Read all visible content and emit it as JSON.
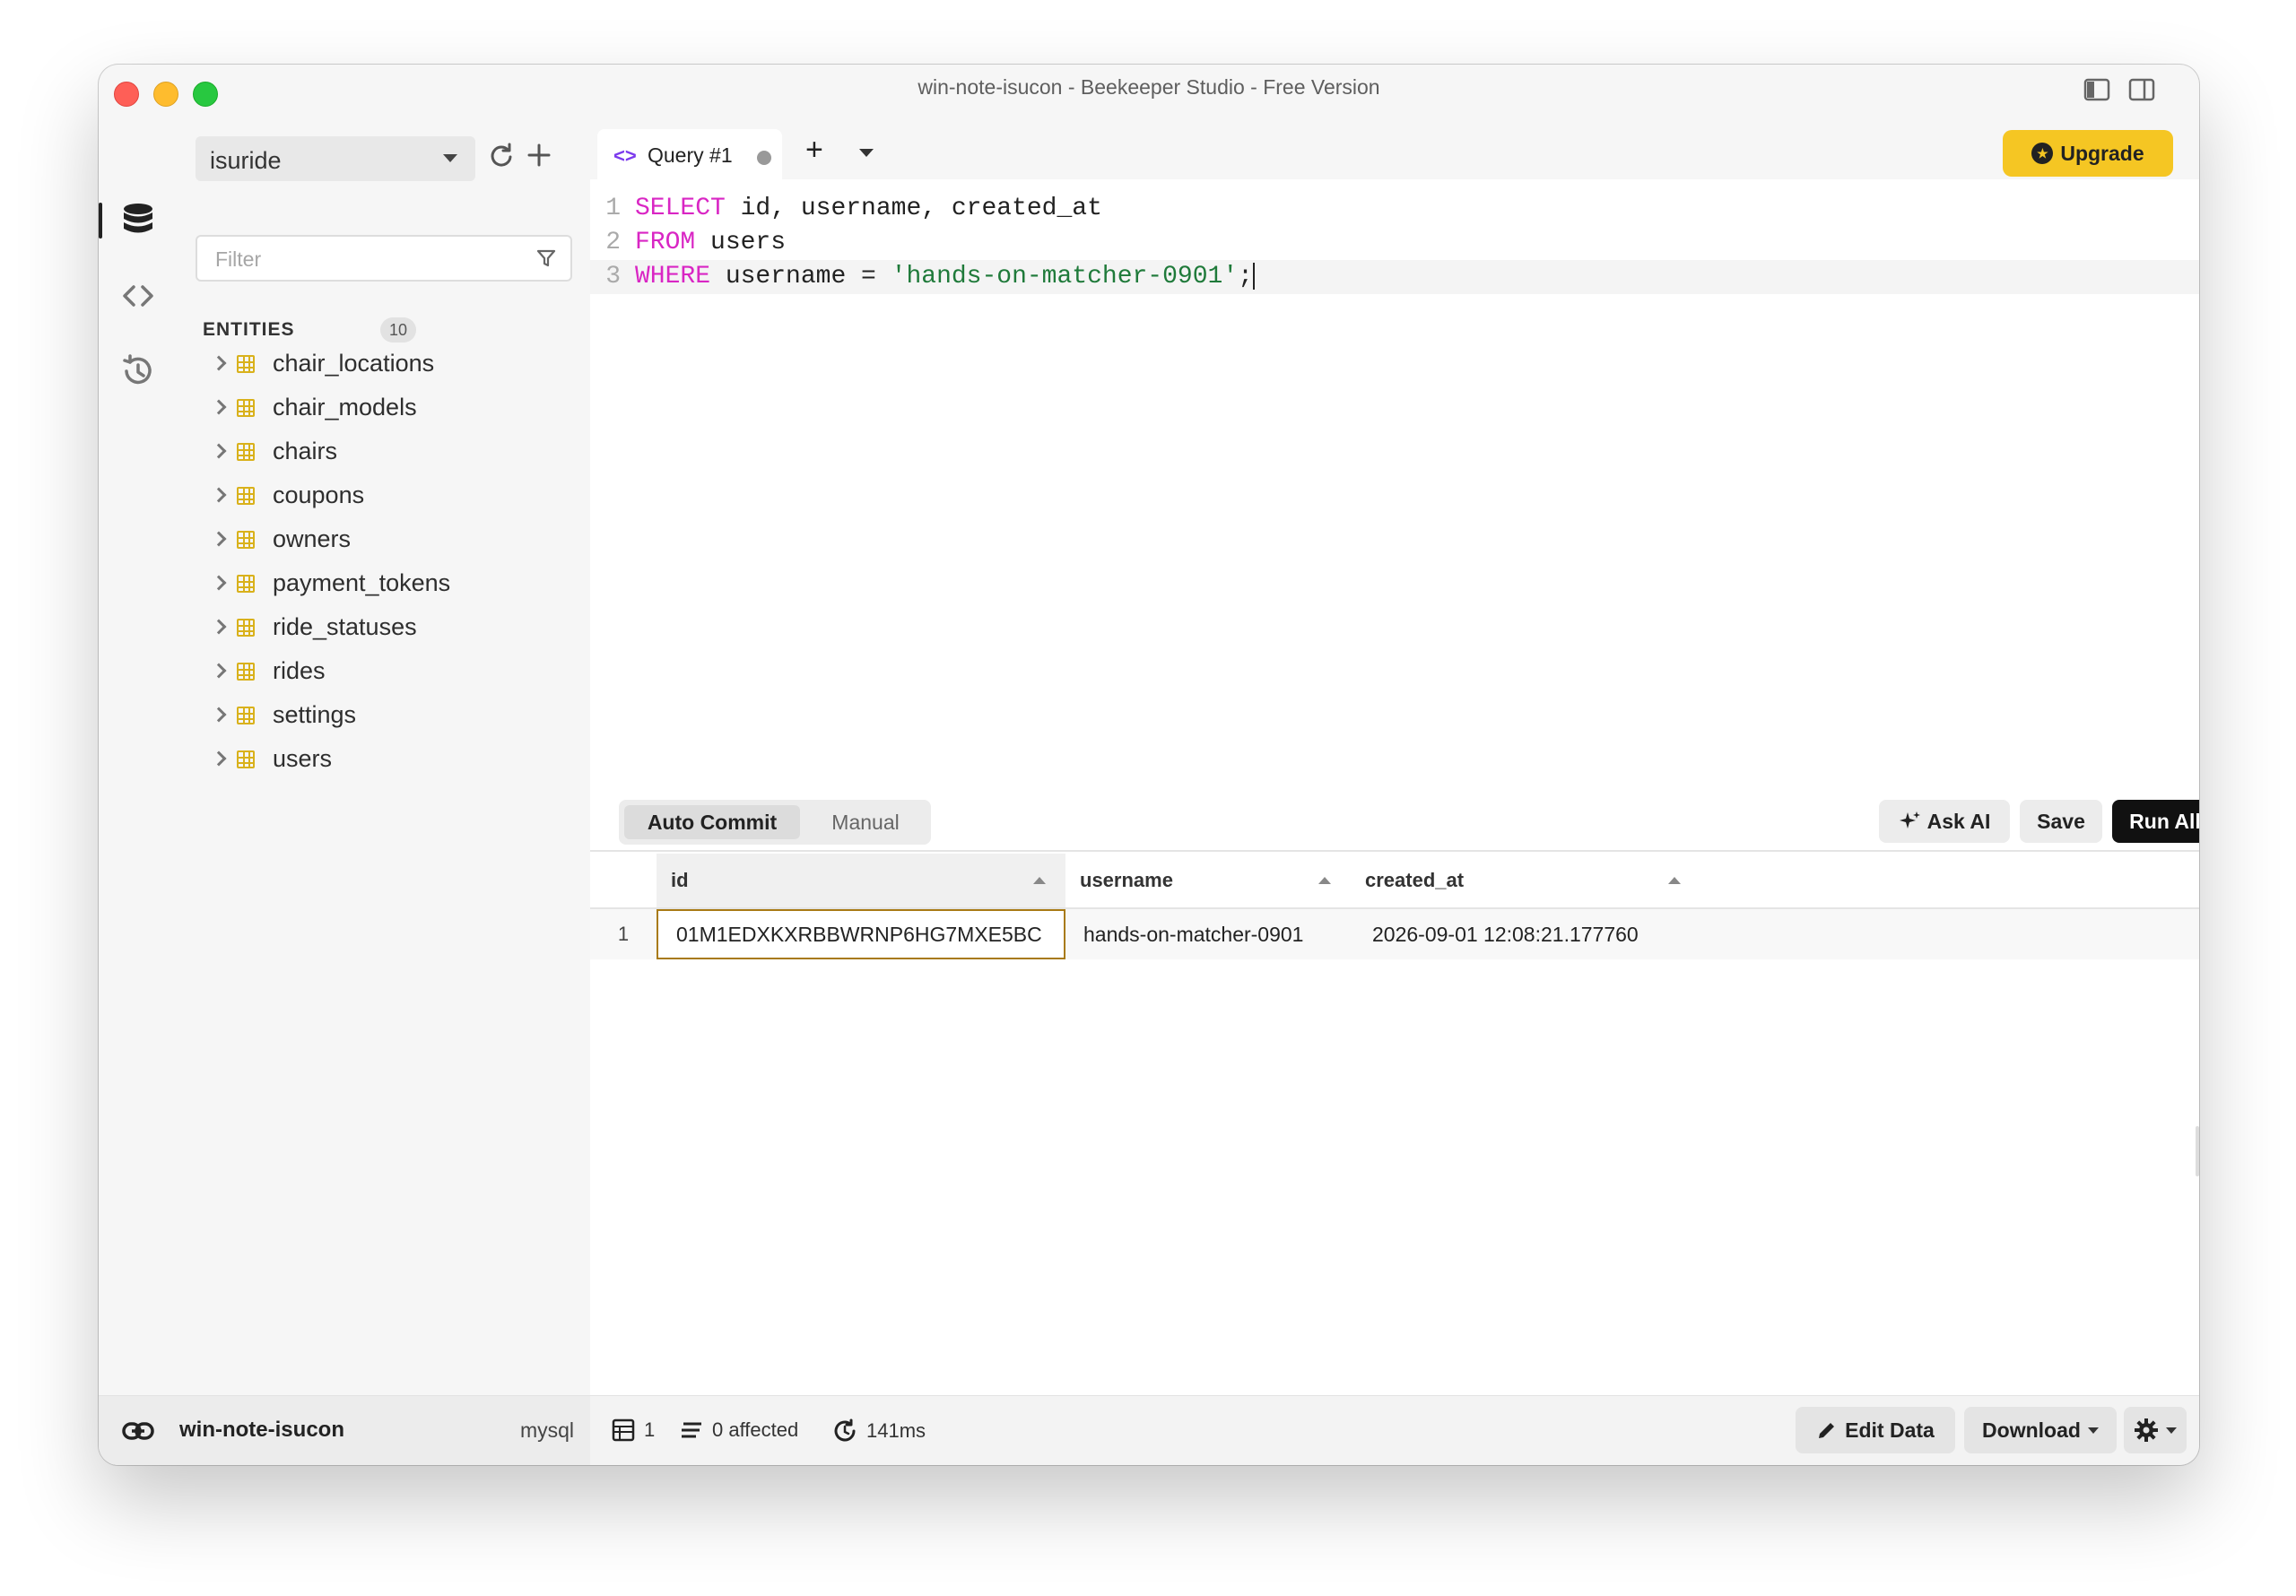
{
  "window": {
    "title": "win-note-isucon - Beekeeper Studio - Free Version"
  },
  "sidebar": {
    "database": "isuride",
    "filter_placeholder": "Filter",
    "entities_label": "ENTITIES",
    "entities_count": "10",
    "entities": [
      {
        "label": "chair_locations"
      },
      {
        "label": "chair_models"
      },
      {
        "label": "chairs"
      },
      {
        "label": "coupons"
      },
      {
        "label": "owners"
      },
      {
        "label": "payment_tokens"
      },
      {
        "label": "ride_statuses"
      },
      {
        "label": "rides"
      },
      {
        "label": "settings"
      },
      {
        "label": "users"
      }
    ]
  },
  "tabs": {
    "query_tab_label": "Query #1",
    "upgrade_label": "Upgrade"
  },
  "editor": {
    "line_numbers": [
      "1",
      "2",
      "3"
    ],
    "line1": {
      "kw": "SELECT",
      "rest": " id, username, created_at"
    },
    "line2": {
      "kw": "FROM",
      "rest": " users"
    },
    "line3": {
      "kw": "WHERE",
      "mid": " username = ",
      "str": "'hands-on-matcher-0901'",
      "end": ";"
    }
  },
  "query_toolbar": {
    "auto_commit": "Auto Commit",
    "manual": "Manual",
    "ask_ai": "Ask AI",
    "save": "Save",
    "run_all": "Run All"
  },
  "results": {
    "columns": [
      "id",
      "username",
      "created_at"
    ],
    "rows": [
      {
        "num": "1",
        "id": "01M1EDXKXRBBWRNP6HG7MXE5BC",
        "username": "hands-on-matcher-0901",
        "created_at": "2026-09-01 12:08:21.177760"
      }
    ]
  },
  "footer": {
    "connection": "win-note-isucon",
    "db_type": "mysql",
    "row_count": "1",
    "affected": "0 affected",
    "duration": "141ms",
    "edit_data": "Edit Data",
    "download": "Download"
  },
  "colors": {
    "accent_yellow": "#f5c623",
    "keyword": "#d926c4",
    "string": "#1f7a3a",
    "table_icon": "#d9b11b"
  }
}
